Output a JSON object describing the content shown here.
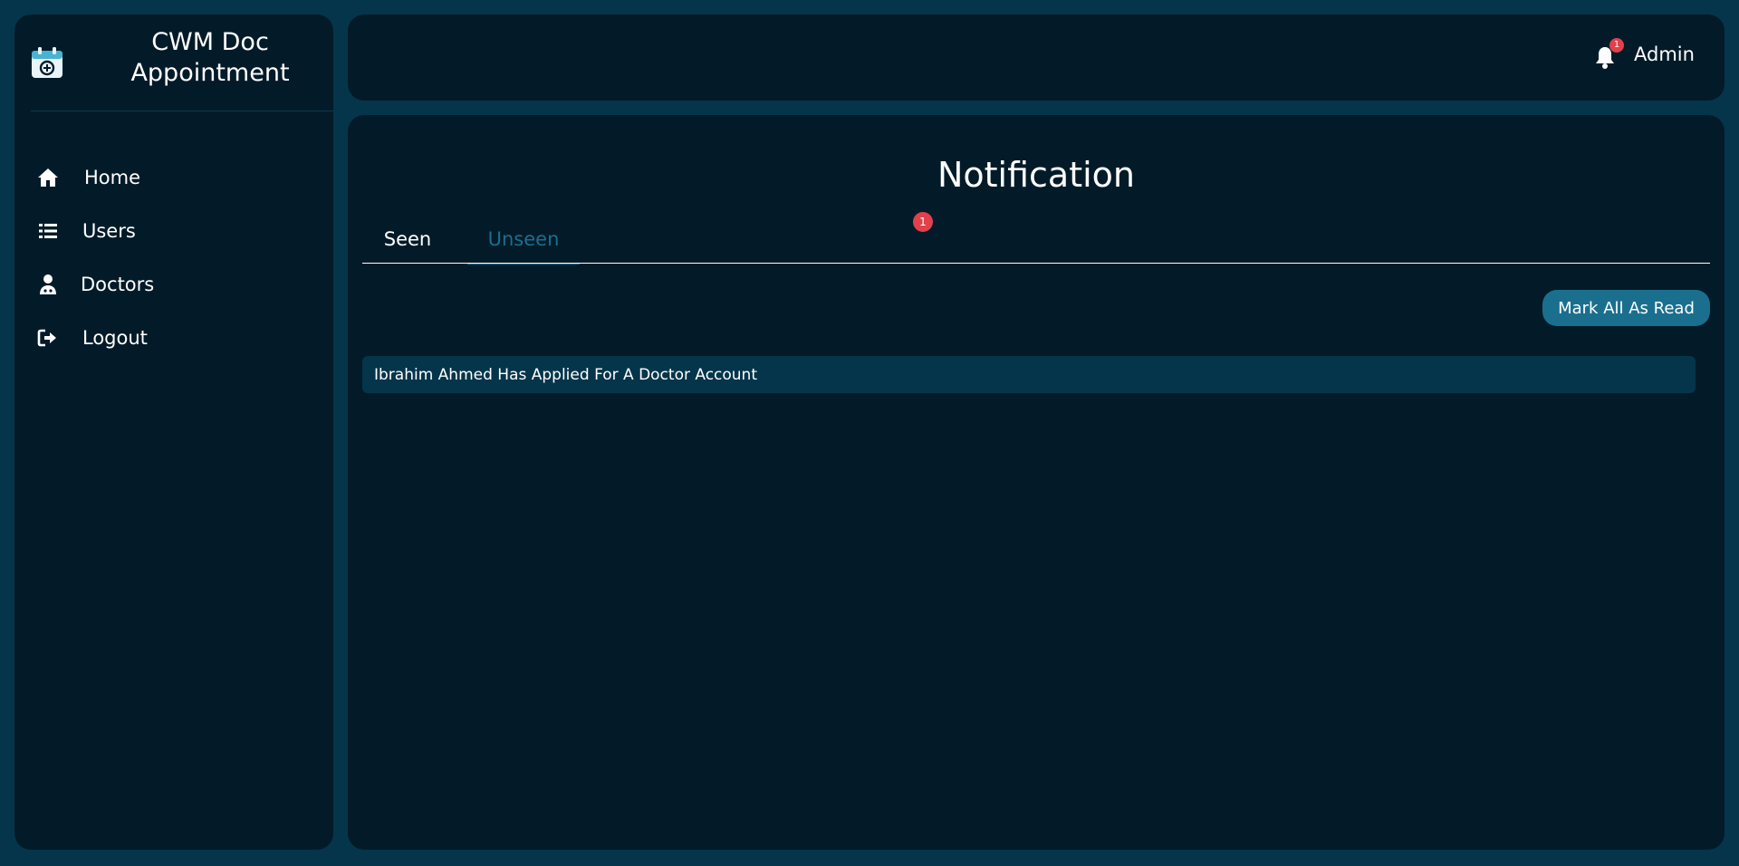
{
  "brand": {
    "title": "CWM Doc Appointment",
    "icon": "calendar-plus-icon"
  },
  "sidebar": {
    "items": [
      {
        "label": "Home",
        "icon": "home-icon"
      },
      {
        "label": "Users",
        "icon": "list-icon"
      },
      {
        "label": "Doctors",
        "icon": "doctor-icon"
      },
      {
        "label": "Logout",
        "icon": "logout-icon"
      }
    ]
  },
  "header": {
    "user_name": "Admin",
    "notification_count": "1"
  },
  "page": {
    "title": "Notification"
  },
  "tabs": [
    {
      "label": "Seen",
      "active": false
    },
    {
      "label": "Unseen",
      "active": true,
      "badge": "1"
    }
  ],
  "actions": {
    "mark_all_label": "Mark All As Read"
  },
  "notifications": [
    {
      "message": "Ibrahim Ahmed Has Applied For A Doctor Account"
    }
  ],
  "colors": {
    "background": "#05354a",
    "panel": "#031b28",
    "accent": "#1a6f8e",
    "badge": "#e0414b"
  }
}
